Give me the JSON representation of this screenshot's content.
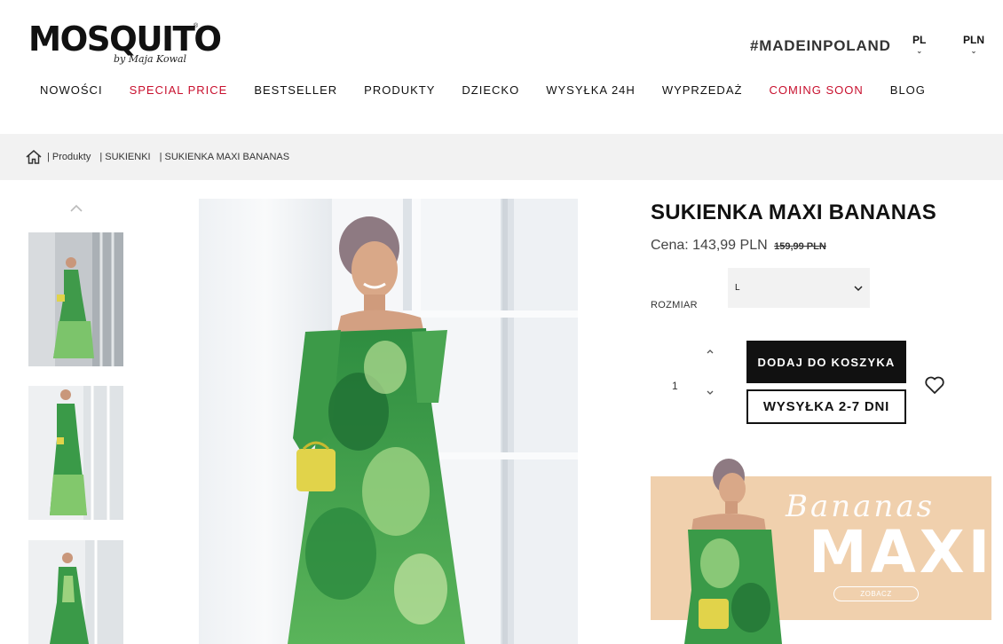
{
  "header": {
    "logo_text": "MOSQUITO",
    "logo_registered": "®",
    "logo_sub": "by Maja Kowal",
    "tagline": "#MADEINPOLAND",
    "language": "PL",
    "currency": "PLN"
  },
  "nav": [
    {
      "label": "NOWOŚCI",
      "color": "#111111"
    },
    {
      "label": "SPECIAL PRICE",
      "color": "#c8102e"
    },
    {
      "label": "BESTSELLER",
      "color": "#111111"
    },
    {
      "label": "PRODUKTY",
      "color": "#111111"
    },
    {
      "label": "DZIECKO",
      "color": "#111111"
    },
    {
      "label": "WYSYŁKA 24H",
      "color": "#111111"
    },
    {
      "label": "WYPRZEDAŻ",
      "color": "#111111"
    },
    {
      "label": "COMING SOON",
      "color": "#c8102e"
    },
    {
      "label": "BLOG",
      "color": "#111111"
    }
  ],
  "breadcrumb": [
    "| Produkty",
    "| SUKIENKI",
    "| SUKIENKA MAXI BANANAS"
  ],
  "product": {
    "title": "SUKIENKA MAXI BANANAS",
    "price_label": "Cena: 143,99 PLN",
    "old_price": "159,99 PLN",
    "size_label": "ROZMIAR",
    "size_value": "L",
    "quantity": "1",
    "add_to_cart": "DODAJ DO KOSZYKA",
    "shipping": "WYSYŁKA 2-7 DNI"
  },
  "banner": {
    "script_text": "Bananas",
    "big_text": "MAXI",
    "button": "ZOBACZ"
  }
}
